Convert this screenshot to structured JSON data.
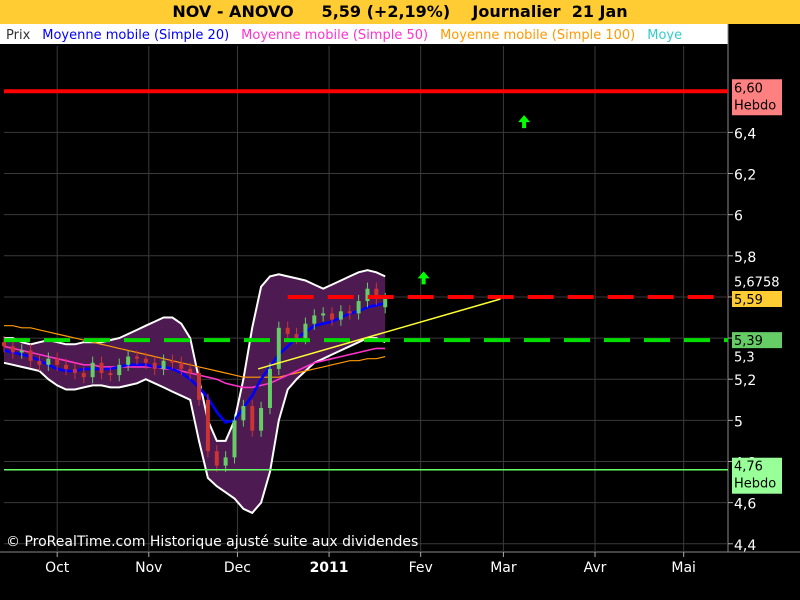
{
  "title": "NOV - ANOVO     5,59 (+2,19%)    Journalier  21 Jan",
  "copyright": "© ProRealTime.com Historique ajusté suite aux dividendes",
  "colors": {
    "background": "#000000",
    "title_bg": "#ffcc33",
    "legend_bg": "#ffffff",
    "bollinger_fill": "#4d1a52",
    "mm20": "#0000ff",
    "mm50": "#ff33cc",
    "mm100": "#ff9900",
    "candle_up": "#66cc66",
    "candle_down": "#cc3333",
    "resistance": "#ff0000",
    "support": "#00dd00",
    "trendline": "#ffff33",
    "support_low": "#66ff66"
  },
  "legend": [
    "Prix",
    "Moyenne mobile (Simple 20)",
    "Moyenne mobile (Simple 50)",
    "Moyenne mobile (Simple 100)",
    "Moye"
  ],
  "chart_data": {
    "type": "candlestick",
    "x_axis": {
      "ticks": [
        {
          "label": "Oct",
          "date": "2010-10-01"
        },
        {
          "label": "Nov",
          "date": "2010-11-01"
        },
        {
          "label": "Dec",
          "date": "2010-12-01"
        },
        {
          "label": "2011",
          "date": "2011-01-01"
        },
        {
          "label": "Fev",
          "date": "2011-02-01"
        },
        {
          "label": "Mar",
          "date": "2011-03-01"
        },
        {
          "label": "Avr",
          "date": "2011-04-01"
        },
        {
          "label": "Mai",
          "date": "2011-05-01"
        }
      ],
      "range": [
        "2010-09-13",
        "2011-05-16"
      ]
    },
    "y_axis": {
      "ticks": [
        {
          "value": 4.4,
          "label": "4,4"
        },
        {
          "value": 4.6,
          "label": "4,6"
        },
        {
          "value": 4.8,
          "label": "4,8"
        },
        {
          "value": 5.0,
          "label": "5"
        },
        {
          "value": 5.2,
          "label": "5,2"
        },
        {
          "value": 5.4,
          "label": "5,4"
        },
        {
          "value": 5.6,
          "label": "5,6"
        },
        {
          "value": 5.8,
          "label": "5,8"
        },
        {
          "value": 6.0,
          "label": "6"
        },
        {
          "value": 6.2,
          "label": "6,2"
        },
        {
          "value": 6.4,
          "label": "6,4"
        }
      ],
      "ylim": [
        4.36,
        6.82
      ]
    },
    "price_labels": [
      {
        "text": "6,60",
        "sub": "Hebdo",
        "value": 6.6,
        "bg": "#ff8080",
        "fg": "#000000"
      },
      {
        "text": "5,6758",
        "value": 5.675,
        "bg": "#000000",
        "fg": "#ffffff"
      },
      {
        "text": "5,59",
        "value": 5.59,
        "bg": "#ffcc33",
        "fg": "#000000"
      },
      {
        "text": "5,39",
        "value": 5.39,
        "bg": "#66cc66",
        "fg": "#000000"
      },
      {
        "text": "5,3",
        "value": 5.31,
        "bg": "#000000",
        "fg": "#ffffff"
      },
      {
        "text": "4,76",
        "sub": "Hebdo",
        "value": 4.76,
        "bg": "#99ff99",
        "fg": "#000000"
      }
    ],
    "horizontal_lines": [
      {
        "name": "resistance-weekly",
        "value": 6.6,
        "color": "#ff0000",
        "dash": false
      },
      {
        "name": "resistance-dashed",
        "value": 5.6,
        "color": "#ff0000",
        "dash": true,
        "from": "2010-12-18"
      },
      {
        "name": "support-dashed",
        "value": 5.39,
        "color": "#00dd00",
        "dash": true
      },
      {
        "name": "support-weekly",
        "value": 4.76,
        "color": "#66ff66",
        "dash": false
      }
    ],
    "trendline": {
      "from": {
        "date": "2010-12-08",
        "value": 5.25
      },
      "to": {
        "date": "2011-02-28",
        "value": 5.59
      }
    },
    "arrows": [
      {
        "date": "2011-03-08",
        "value": 6.45
      },
      {
        "date": "2011-02-02",
        "value": 5.69
      }
    ],
    "series": {
      "dates": [
        "2010-09-13",
        "2010-09-16",
        "2010-09-19",
        "2010-09-22",
        "2010-09-25",
        "2010-09-28",
        "2010-10-01",
        "2010-10-04",
        "2010-10-07",
        "2010-10-10",
        "2010-10-13",
        "2010-10-16",
        "2010-10-19",
        "2010-10-22",
        "2010-10-25",
        "2010-10-28",
        "2010-10-31",
        "2010-11-03",
        "2010-11-06",
        "2010-11-09",
        "2010-11-12",
        "2010-11-15",
        "2010-11-18",
        "2010-11-21",
        "2010-11-24",
        "2010-11-27",
        "2010-11-30",
        "2010-12-03",
        "2010-12-06",
        "2010-12-09",
        "2010-12-12",
        "2010-12-15",
        "2010-12-18",
        "2010-12-21",
        "2010-12-24",
        "2010-12-27",
        "2010-12-30",
        "2011-01-02",
        "2011-01-05",
        "2011-01-08",
        "2011-01-11",
        "2011-01-14",
        "2011-01-17",
        "2011-01-20"
      ],
      "close": [
        5.36,
        5.33,
        5.34,
        5.29,
        5.27,
        5.3,
        5.27,
        5.25,
        5.23,
        5.21,
        5.28,
        5.23,
        5.22,
        5.27,
        5.31,
        5.3,
        5.28,
        5.25,
        5.29,
        5.28,
        5.25,
        5.23,
        5.1,
        4.85,
        4.78,
        4.82,
        5.0,
        5.07,
        4.95,
        5.06,
        5.25,
        5.45,
        5.42,
        5.4,
        5.47,
        5.51,
        5.52,
        5.49,
        5.53,
        5.52,
        5.58,
        5.64,
        5.59,
        5.59
      ],
      "open": [
        5.38,
        5.36,
        5.33,
        5.34,
        5.29,
        5.27,
        5.3,
        5.27,
        5.25,
        5.23,
        5.21,
        5.28,
        5.23,
        5.22,
        5.27,
        5.31,
        5.3,
        5.28,
        5.25,
        5.29,
        5.28,
        5.25,
        5.23,
        5.1,
        4.85,
        4.78,
        4.82,
        5.0,
        5.07,
        4.95,
        5.06,
        5.25,
        5.45,
        5.42,
        5.4,
        5.47,
        5.51,
        5.52,
        5.49,
        5.53,
        5.52,
        5.58,
        5.64,
        5.55
      ],
      "sma20": [
        5.34,
        5.33,
        5.32,
        5.31,
        5.29,
        5.27,
        5.25,
        5.24,
        5.24,
        5.25,
        5.25,
        5.25,
        5.25,
        5.26,
        5.27,
        5.27,
        5.27,
        5.26,
        5.26,
        5.25,
        5.23,
        5.2,
        5.16,
        5.11,
        5.04,
        4.99,
        5.0,
        5.06,
        5.12,
        5.2,
        5.26,
        5.32,
        5.36,
        5.4,
        5.43,
        5.46,
        5.47,
        5.48,
        5.5,
        5.52,
        5.53,
        5.55,
        5.56,
        5.57
      ],
      "sma50": [
        5.36,
        5.35,
        5.34,
        5.33,
        5.32,
        5.31,
        5.3,
        5.29,
        5.28,
        5.27,
        5.27,
        5.26,
        5.26,
        5.26,
        5.26,
        5.26,
        5.26,
        5.26,
        5.25,
        5.25,
        5.24,
        5.23,
        5.22,
        5.21,
        5.2,
        5.18,
        5.17,
        5.16,
        5.16,
        5.17,
        5.18,
        5.2,
        5.22,
        5.24,
        5.26,
        5.28,
        5.29,
        5.3,
        5.31,
        5.32,
        5.33,
        5.34,
        5.35,
        5.35
      ],
      "sma100": [
        5.46,
        5.46,
        5.45,
        5.45,
        5.44,
        5.43,
        5.42,
        5.41,
        5.4,
        5.39,
        5.38,
        5.37,
        5.36,
        5.35,
        5.34,
        5.33,
        5.32,
        5.31,
        5.3,
        5.29,
        5.28,
        5.27,
        5.26,
        5.25,
        5.24,
        5.23,
        5.22,
        5.21,
        5.21,
        5.21,
        5.21,
        5.21,
        5.22,
        5.23,
        5.24,
        5.25,
        5.26,
        5.27,
        5.28,
        5.29,
        5.29,
        5.3,
        5.3,
        5.31
      ],
      "boll_upper": [
        5.4,
        5.4,
        5.38,
        5.37,
        5.38,
        5.39,
        5.38,
        5.37,
        5.37,
        5.38,
        5.38,
        5.38,
        5.39,
        5.4,
        5.42,
        5.44,
        5.46,
        5.48,
        5.5,
        5.5,
        5.47,
        5.4,
        5.2,
        5.0,
        4.9,
        4.9,
        5.0,
        5.2,
        5.45,
        5.65,
        5.7,
        5.71,
        5.7,
        5.69,
        5.68,
        5.66,
        5.64,
        5.66,
        5.68,
        5.7,
        5.72,
        5.73,
        5.72,
        5.7
      ],
      "boll_lower": [
        5.28,
        5.27,
        5.26,
        5.25,
        5.24,
        5.2,
        5.17,
        5.15,
        5.15,
        5.16,
        5.17,
        5.17,
        5.16,
        5.16,
        5.17,
        5.18,
        5.2,
        5.18,
        5.16,
        5.14,
        5.12,
        5.1,
        4.9,
        4.72,
        4.68,
        4.65,
        4.62,
        4.57,
        4.55,
        4.6,
        4.75,
        5.0,
        5.15,
        5.2,
        5.24,
        5.28,
        5.3,
        5.32,
        5.34,
        5.36,
        5.38,
        5.4,
        5.4,
        5.38
      ]
    }
  }
}
